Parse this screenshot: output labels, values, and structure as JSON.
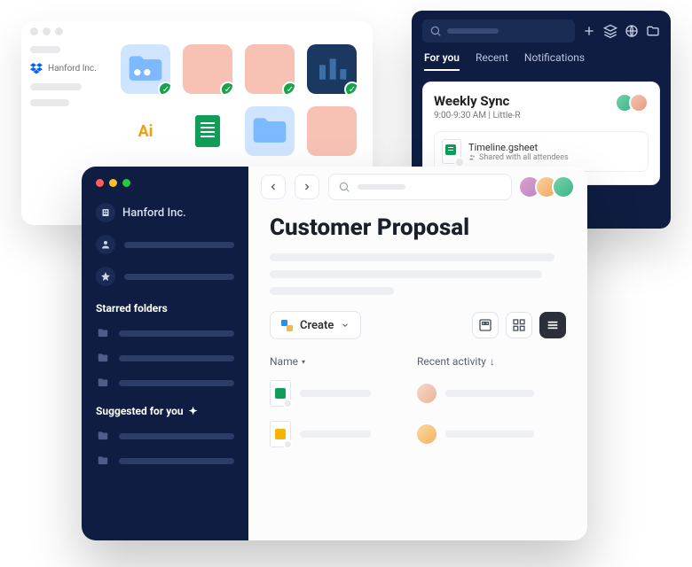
{
  "win1": {
    "brand": "Hanford Inc."
  },
  "win2": {
    "tabs": [
      "For you",
      "Recent",
      "Notifications"
    ],
    "card": {
      "title": "Weekly Sync",
      "subtitle": "9:00-9:30 AM | Little-R",
      "file_name": "Timeline.gsheet",
      "file_shared": "Shared with all attendees"
    }
  },
  "win3": {
    "brand": "Hanford Inc.",
    "sections": {
      "starred": "Starred folders",
      "suggested": "Suggested for you"
    },
    "page_title": "Customer Proposal",
    "create_label": "Create",
    "columns": {
      "name": "Name",
      "activity": "Recent activity"
    }
  }
}
